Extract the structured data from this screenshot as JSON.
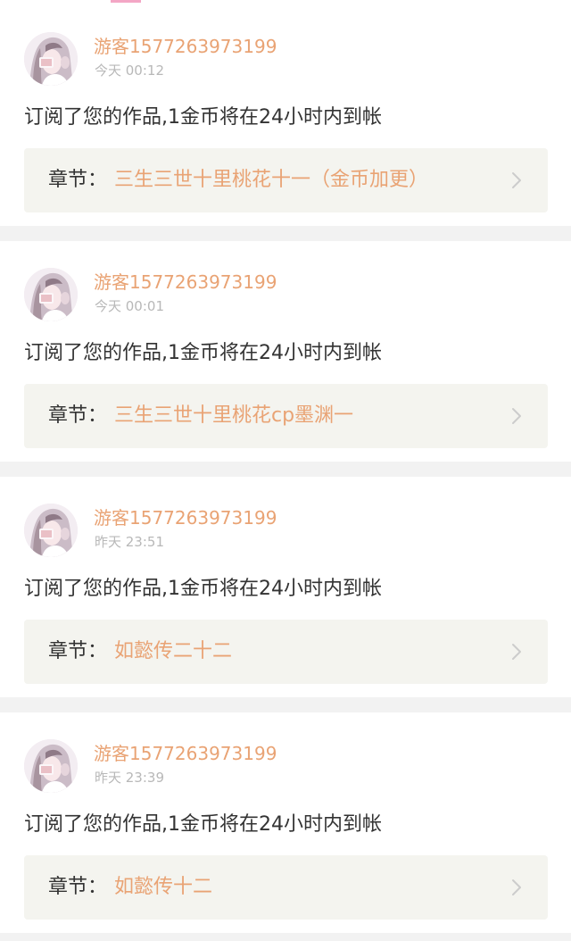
{
  "colors": {
    "accent": "#e9a374",
    "page_bg": "#f2f2f2",
    "card_bg": "#ffffff",
    "chapter_box_bg": "#f4f4ef",
    "muted_text": "#b8b8b8",
    "body_text": "#333333",
    "chevron": "#cccccc"
  },
  "notifications": [
    {
      "username": "游客1577263973199",
      "time": "今天 00:12",
      "message": "订阅了您的作品,1金币将在24小时内到帐",
      "chapter_prefix": "章节：",
      "chapter_title": "三生三世十里桃花十一（金币加更）",
      "avatar_icon": "avatar-icon",
      "chevron_icon": "chevron-right-icon"
    },
    {
      "username": "游客1577263973199",
      "time": "今天 00:01",
      "message": "订阅了您的作品,1金币将在24小时内到帐",
      "chapter_prefix": "章节：",
      "chapter_title": "三生三世十里桃花cp墨渊一",
      "avatar_icon": "avatar-icon",
      "chevron_icon": "chevron-right-icon"
    },
    {
      "username": "游客1577263973199",
      "time": "昨天 23:51",
      "message": "订阅了您的作品,1金币将在24小时内到帐",
      "chapter_prefix": "章节：",
      "chapter_title": "如懿传二十二",
      "avatar_icon": "avatar-icon",
      "chevron_icon": "chevron-right-icon"
    },
    {
      "username": "游客1577263973199",
      "time": "昨天 23:39",
      "message": "订阅了您的作品,1金币将在24小时内到帐",
      "chapter_prefix": "章节：",
      "chapter_title": "如懿传十二",
      "avatar_icon": "avatar-icon",
      "chevron_icon": "chevron-right-icon"
    }
  ]
}
